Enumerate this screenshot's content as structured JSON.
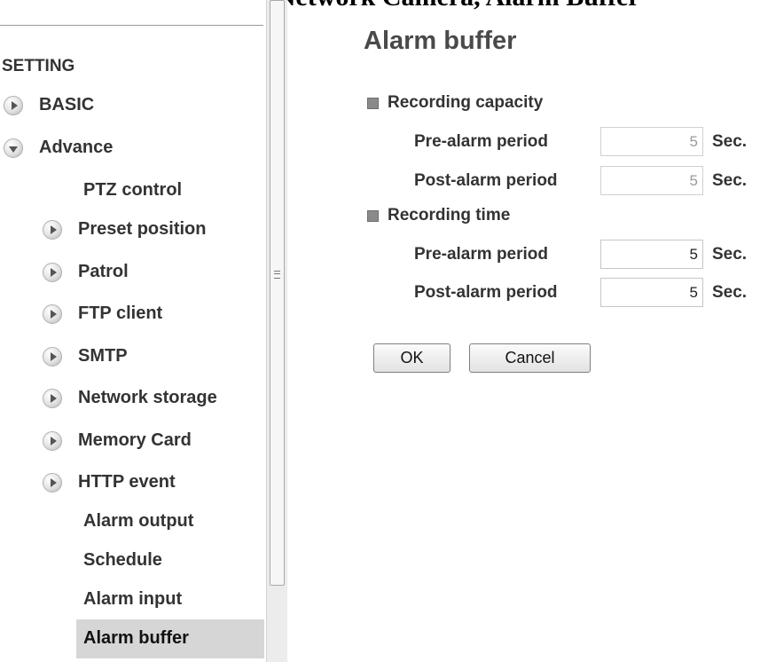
{
  "top_caption": "I-PRO SERIES Setting, Network Camera, Alarm Buffer",
  "sidebar": {
    "heading": "SETTING",
    "basic_label": "BASIC",
    "advance_label": "Advance",
    "items": [
      {
        "label": "PTZ control"
      },
      {
        "label": "Preset position"
      },
      {
        "label": "Patrol"
      },
      {
        "label": "FTP client"
      },
      {
        "label": "SMTP"
      },
      {
        "label": "Network storage"
      },
      {
        "label": "Memory Card"
      },
      {
        "label": "HTTP event"
      },
      {
        "label": "Alarm output"
      },
      {
        "label": "Schedule"
      },
      {
        "label": "Alarm input"
      },
      {
        "label": "Alarm buffer"
      }
    ],
    "active_item": "Alarm buffer"
  },
  "main": {
    "title": "Alarm buffer",
    "recording_capacity": {
      "title": "Recording capacity",
      "pre_label": "Pre-alarm period",
      "pre_value": "5",
      "post_label": "Post-alarm period",
      "post_value": "5"
    },
    "recording_time": {
      "title": "Recording time",
      "pre_label": "Pre-alarm period",
      "pre_value": "5",
      "post_label": "Post-alarm period",
      "post_value": "5"
    },
    "unit": "Sec.",
    "ok_label": "OK",
    "cancel_label": "Cancel"
  },
  "icons": {
    "collapsed": "chevron-right-circle-icon",
    "expanded": "chevron-down-circle-icon",
    "group_bullet": "square-bullet-icon",
    "scroll_grip": "scroll-grip-icon"
  },
  "colors": {
    "active_item_bg": "#d6d6d6",
    "title_color": "#4a4a4a",
    "text_color": "#333333"
  }
}
